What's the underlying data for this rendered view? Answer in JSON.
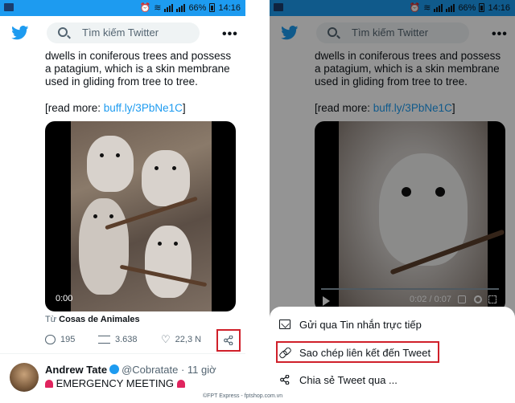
{
  "status_bar": {
    "battery_percent": "66%",
    "time": "14:16"
  },
  "header": {
    "search_placeholder": "Tìm kiếm Twitter",
    "more_label": "•••"
  },
  "tweet": {
    "text": "dwells in coniferous trees and possess a patagium, which is a skin membrane used in gliding from tree to tree.",
    "read_more_prefix": "[read more: ",
    "read_more_link": "buff.ly/3PbNe1C",
    "read_more_suffix": "]",
    "video_time_left": "0:00",
    "video_time_right": "0:02 / 0:07",
    "source_prefix": "Từ ",
    "source_name": "Cosas de Animales",
    "reply_count": "195",
    "retweet_count": "3.638",
    "like_count": "22,3 N"
  },
  "next_tweet": {
    "author_name": "Andrew Tate",
    "handle": "@Cobratate · 11 giờ",
    "text": "EMERGENCY MEETING"
  },
  "share_sheet": {
    "items": [
      {
        "label": "Gửi qua Tin nhắn trực tiếp",
        "icon": "envelope-icon"
      },
      {
        "label": "Sao chép liên kết đến Tweet",
        "icon": "link-icon"
      },
      {
        "label": "Chia sẻ Tweet qua ...",
        "icon": "share-icon"
      }
    ]
  },
  "watermark": "©FPT Express - fptshop.com.vn"
}
